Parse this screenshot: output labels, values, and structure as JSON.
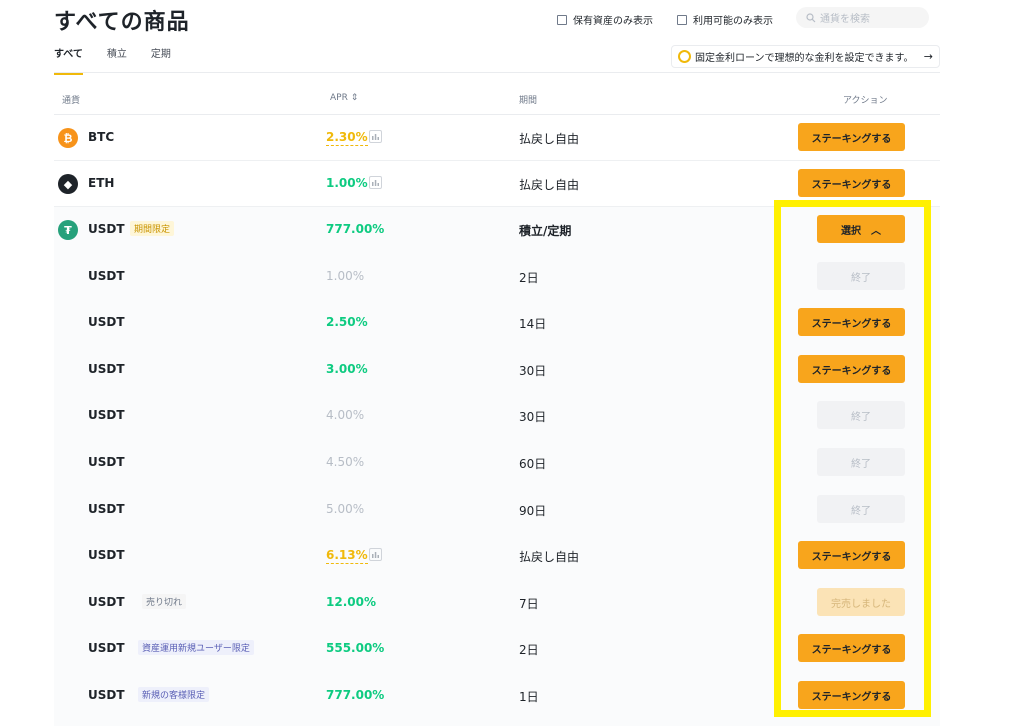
{
  "page": {
    "title": "すべての商品"
  },
  "filters": {
    "holdings_only": "保有資産のみ表示",
    "available_only": "利用可能のみ表示"
  },
  "search": {
    "placeholder": "通貨を検索",
    "icon": "search-icon"
  },
  "tabs": [
    {
      "label": "すべて",
      "active": true
    },
    {
      "label": "積立",
      "active": false
    },
    {
      "label": "定期",
      "active": false
    }
  ],
  "promo": {
    "text": "固定金利ローンで理想的な金利を設定できます。",
    "arrow": "→"
  },
  "table": {
    "headers": {
      "currency": "通貨",
      "apr": "APR ⇕",
      "period": "期間",
      "action": "アクション"
    },
    "rows": [
      {
        "coin": "BTC",
        "tag": "",
        "apr": "2.30%",
        "period": "払戻し自由",
        "action": "ステーキングする"
      },
      {
        "coin": "ETH",
        "tag": "",
        "apr": "1.00%",
        "period": "払戻し自由",
        "action": "ステーキングする"
      },
      {
        "coin": "USDT",
        "tag": "期間限定",
        "apr": "777.00%",
        "period": "積立/定期",
        "action": "選択"
      },
      {
        "coin": "USDT",
        "tag": "",
        "apr": "1.00%",
        "period": "2日",
        "action": "終了"
      },
      {
        "coin": "USDT",
        "tag": "",
        "apr": "2.50%",
        "period": "14日",
        "action": "ステーキングする"
      },
      {
        "coin": "USDT",
        "tag": "",
        "apr": "3.00%",
        "period": "30日",
        "action": "ステーキングする"
      },
      {
        "coin": "USDT",
        "tag": "",
        "apr": "4.00%",
        "period": "30日",
        "action": "終了"
      },
      {
        "coin": "USDT",
        "tag": "",
        "apr": "4.50%",
        "period": "60日",
        "action": "終了"
      },
      {
        "coin": "USDT",
        "tag": "",
        "apr": "5.00%",
        "period": "90日",
        "action": "終了"
      },
      {
        "coin": "USDT",
        "tag": "",
        "apr": "6.13%",
        "period": "払戻し自由",
        "action": "ステーキングする"
      },
      {
        "coin": "USDT",
        "tag": "売り切れ",
        "apr": "12.00%",
        "period": "7日",
        "action": "完売しました"
      },
      {
        "coin": "USDT",
        "tag": "資産運用新規ユーザー限定",
        "apr": "555.00%",
        "period": "2日",
        "action": "ステーキングする"
      },
      {
        "coin": "USDT",
        "tag": "新規の客様限定",
        "apr": "777.00%",
        "period": "1日",
        "action": "ステーキングする"
      }
    ]
  },
  "colors": {
    "accent": "#f8a51c",
    "green": "#0ecb81",
    "highlight": "#fff000"
  }
}
